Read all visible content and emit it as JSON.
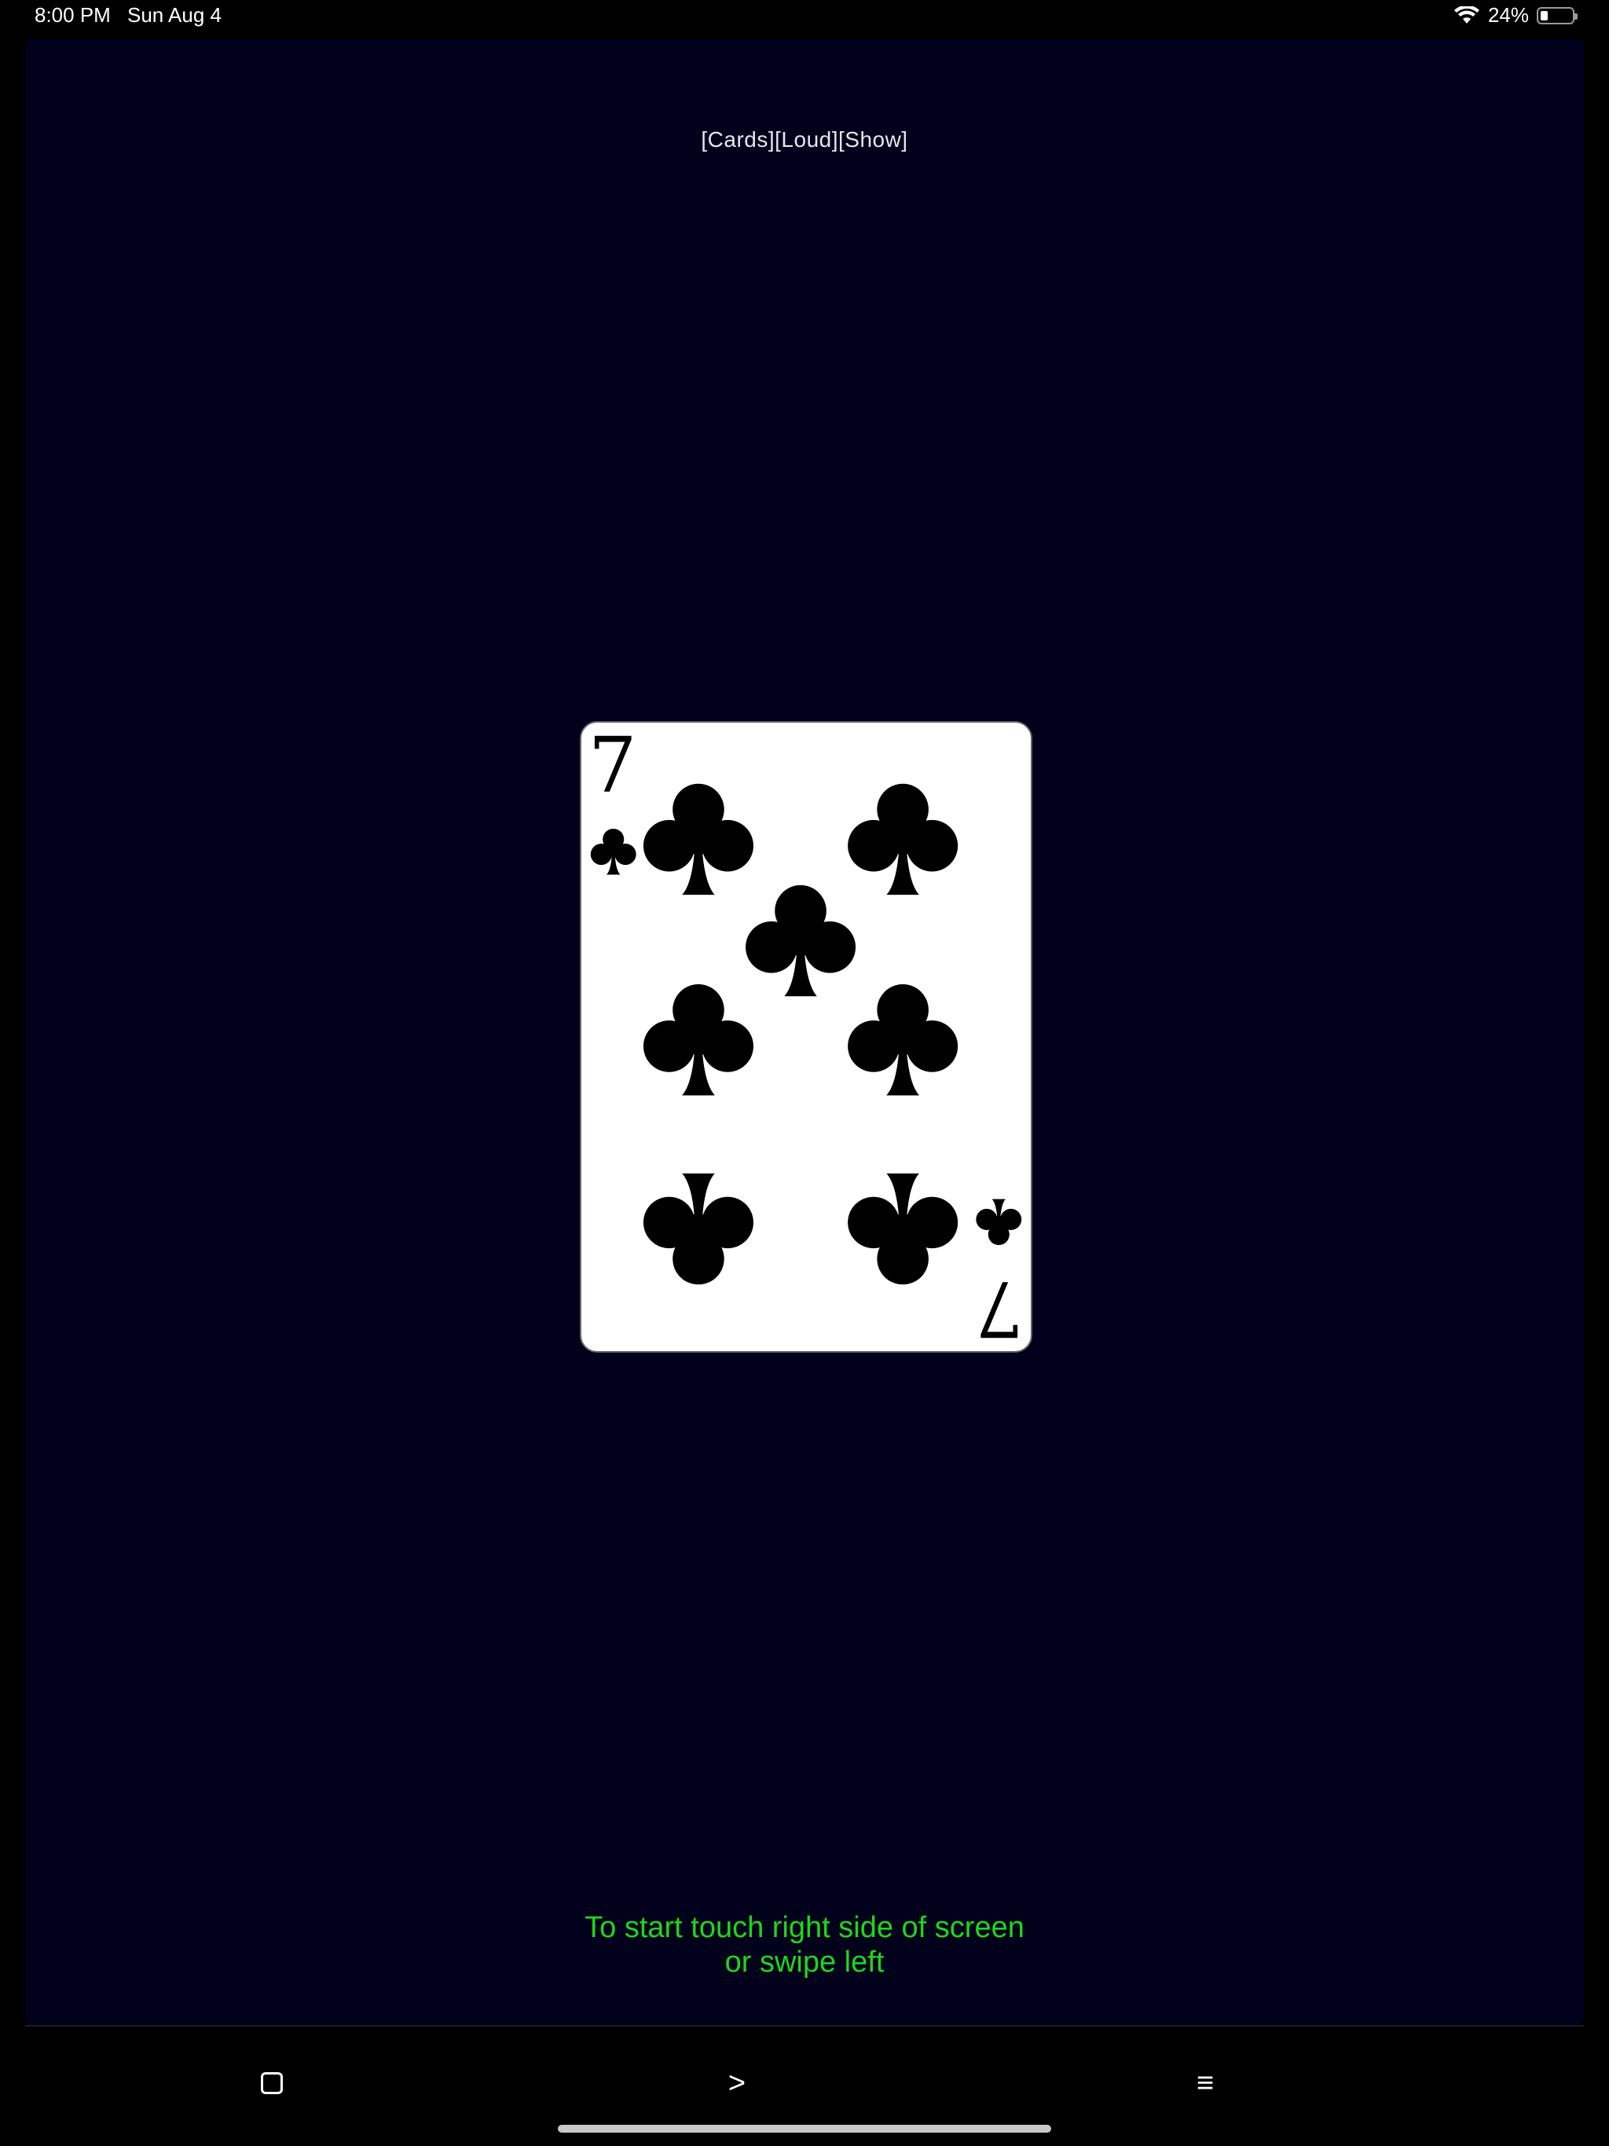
{
  "status_bar": {
    "time": "8:00 PM",
    "date": "Sun Aug 4",
    "battery_text": "24%",
    "battery_level": 0.24
  },
  "header": {
    "tags": "[Cards][Loud][Show]"
  },
  "card": {
    "rank": "7",
    "suit": "clubs",
    "suit_symbol": "♣",
    "face_color": "#ffffff",
    "ink_color": "#000000"
  },
  "hint": {
    "line1": "To start touch right side of screen",
    "line2": "or swipe left"
  },
  "toolbar": {
    "left_icon": "square-icon",
    "next_label": ">",
    "menu_label": "≡"
  },
  "colors": {
    "background": "#02011c",
    "hint_text": "#1ed61e"
  }
}
